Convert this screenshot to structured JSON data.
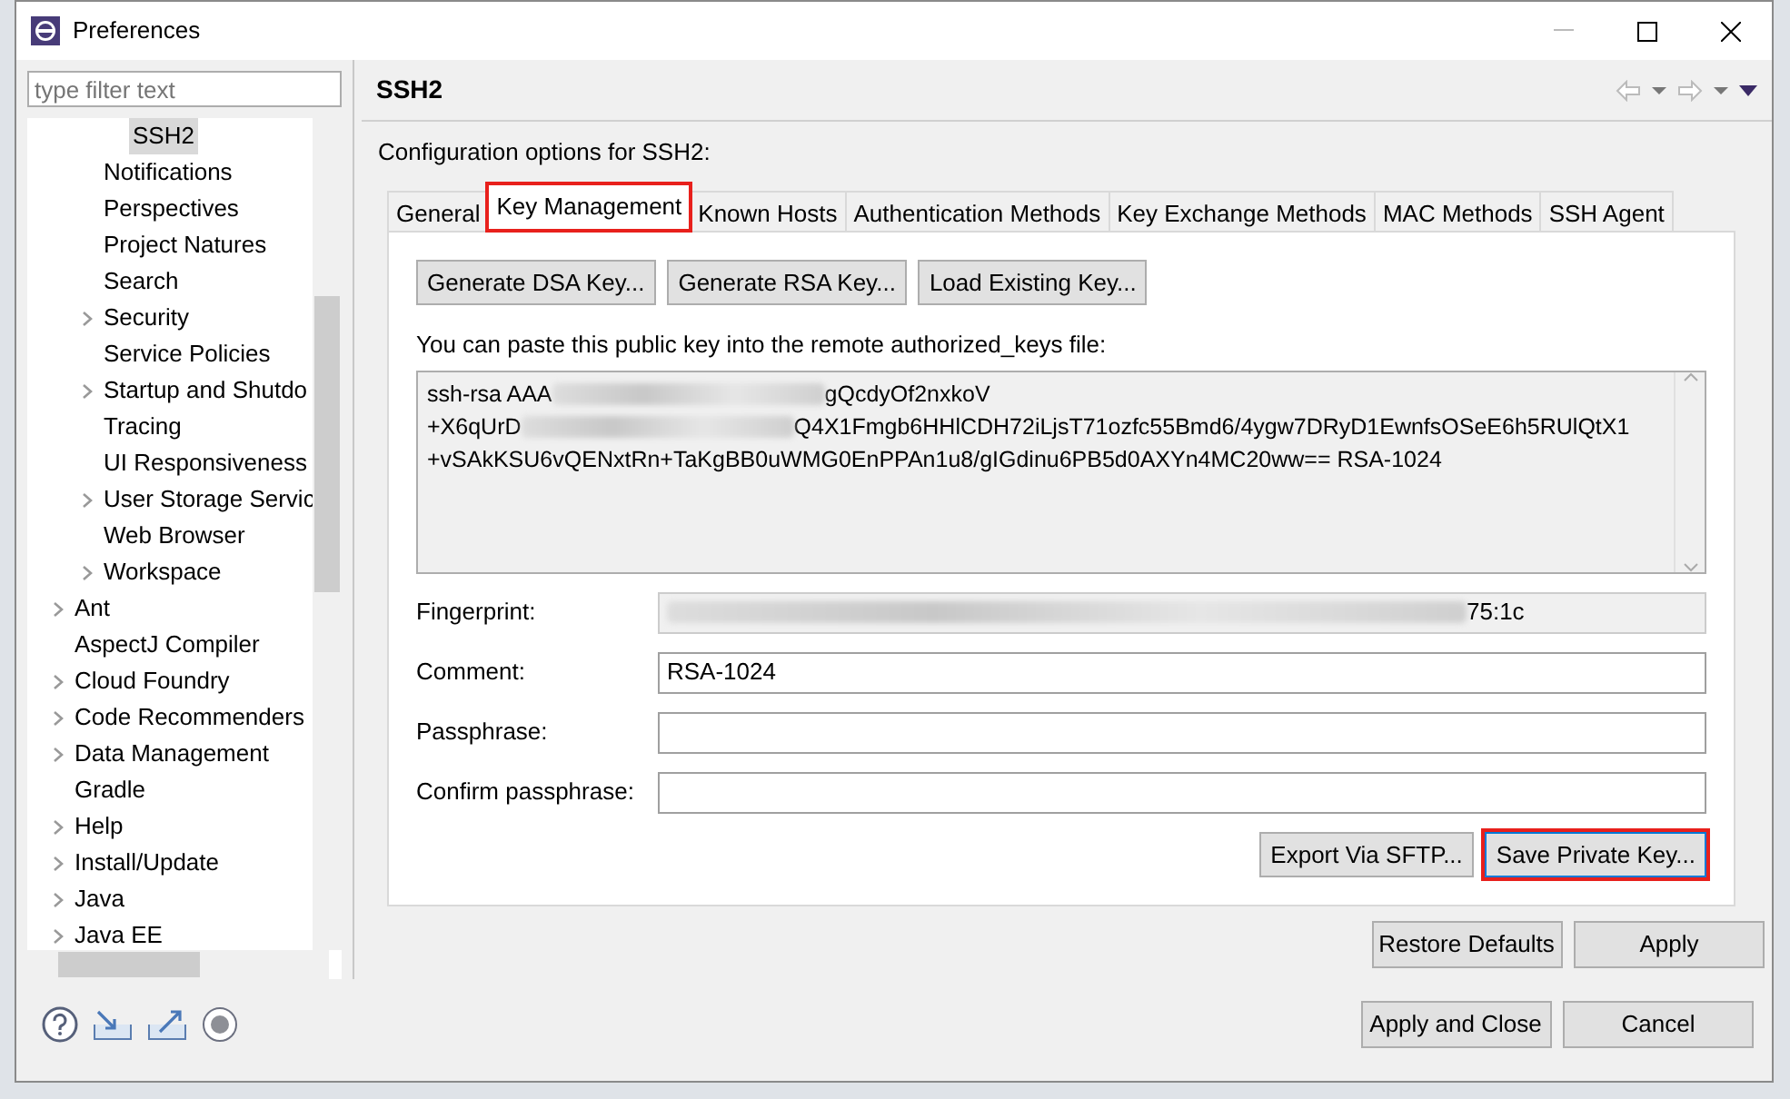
{
  "window": {
    "title": "Preferences"
  },
  "filter": {
    "placeholder": "type filter text"
  },
  "tree": [
    {
      "children": [
        {
          "children": [
            {
              "label": "SSH2",
              "selected": true,
              "collapsed": false
            }
          ]
        },
        {
          "label": "Notifications",
          "selected": false,
          "collapsed": false
        },
        {
          "label": "Perspectives",
          "selected": false,
          "collapsed": false
        },
        {
          "label": "Project Natures",
          "selected": false,
          "collapsed": false
        },
        {
          "label": "Search",
          "selected": false,
          "collapsed": false
        },
        {
          "label": "Security",
          "selected": false,
          "collapsed": true
        },
        {
          "label": "Service Policies",
          "selected": false,
          "collapsed": false
        },
        {
          "label": "Startup and Shutdo",
          "selected": false,
          "collapsed": true
        },
        {
          "label": "Tracing",
          "selected": false,
          "collapsed": false
        },
        {
          "label": "UI Responsiveness",
          "selected": false,
          "collapsed": false
        },
        {
          "label": "User Storage Servic",
          "selected": false,
          "collapsed": true
        },
        {
          "label": "Web Browser",
          "selected": false,
          "collapsed": false
        },
        {
          "label": "Workspace",
          "selected": false,
          "collapsed": true
        }
      ]
    },
    {
      "label": "Ant",
      "selected": false,
      "collapsed": true
    },
    {
      "label": "AspectJ Compiler",
      "selected": false,
      "collapsed": false
    },
    {
      "label": "Cloud Foundry",
      "selected": false,
      "collapsed": true
    },
    {
      "label": "Code Recommenders",
      "selected": false,
      "collapsed": true
    },
    {
      "label": "Data Management",
      "selected": false,
      "collapsed": true
    },
    {
      "label": "Gradle",
      "selected": false,
      "collapsed": false
    },
    {
      "label": "Help",
      "selected": false,
      "collapsed": true
    },
    {
      "label": "Install/Update",
      "selected": false,
      "collapsed": true
    },
    {
      "label": "Java",
      "selected": false,
      "collapsed": true
    },
    {
      "label": "Java EE",
      "selected": false,
      "collapsed": true
    }
  ],
  "page": {
    "title": "SSH2",
    "description": "Configuration options for SSH2:"
  },
  "tabs": [
    {
      "label": "General",
      "selected": false,
      "highlighted": false
    },
    {
      "label": "Key Management",
      "selected": true,
      "highlighted": true
    },
    {
      "label": "Known Hosts",
      "selected": false,
      "highlighted": false
    },
    {
      "label": "Authentication Methods",
      "selected": false,
      "highlighted": false
    },
    {
      "label": "Key Exchange Methods",
      "selected": false,
      "highlighted": false
    },
    {
      "label": "MAC Methods",
      "selected": false,
      "highlighted": false
    },
    {
      "label": "SSH Agent",
      "selected": false,
      "highlighted": false
    }
  ],
  "key_buttons": [
    "Generate DSA Key...",
    "Generate RSA Key...",
    "Load Existing Key..."
  ],
  "paste_hint": "You can paste this public key into the remote authorized_keys file:",
  "public_key": [
    {
      "before": "ssh-rsa AAA",
      "redacted": true,
      "after": "gQcdyOf2nxkoV"
    },
    {
      "before": "+X6qUrD",
      "redacted": true,
      "after": "Q4X1Fmgb6HHlCDH72iLjsT71ozfc55Bmd6/4ygw7DRyD1EwnfsOSeE6h5RUlQtX1"
    },
    {
      "before": "+vSAkKSU6vQENxtRn+TaKgBB0uWMG0EnPPAn1u8/gIGdinu6PB5d0AXYn4MC20ww== RSA-1024",
      "redacted": false
    }
  ],
  "fields": [
    {
      "label": "Fingerprint:",
      "value": "75:1c",
      "redacted": true,
      "disabled": true
    },
    {
      "label": "Comment:",
      "value": "RSA-1024",
      "redacted": false,
      "disabled": false
    },
    {
      "label": "Passphrase:",
      "redacted": false,
      "disabled": false
    },
    {
      "label": "Confirm passphrase:",
      "redacted": false,
      "disabled": false
    }
  ],
  "action_buttons": [
    {
      "label": "Export Via SFTP...",
      "highlighted": false
    },
    {
      "label": "Save Private Key...",
      "highlighted": true
    }
  ],
  "page_buttons": [
    "Restore Defaults",
    "Apply"
  ],
  "dialog_buttons": [
    "Apply and Close",
    "Cancel"
  ]
}
